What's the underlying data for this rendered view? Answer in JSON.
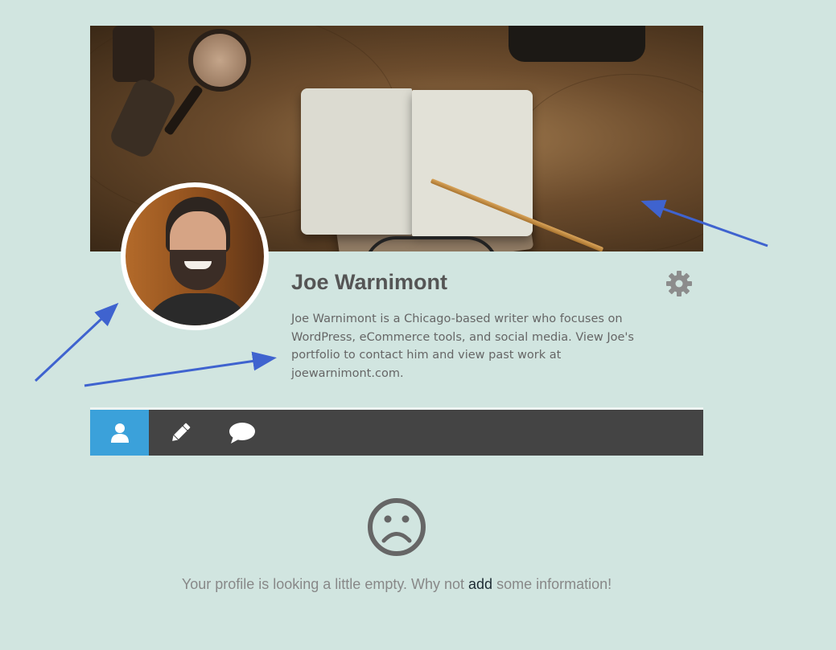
{
  "profile": {
    "name": "Joe Warnimont",
    "bio": "Joe Warnimont is a Chicago-based writer who focuses on WordPress, eCommerce tools, and social media. View Joe's portfolio to contact him and view past work at joewarnimont.com."
  },
  "tabs": [
    {
      "icon": "user-icon",
      "active": true
    },
    {
      "icon": "pencil-icon",
      "active": false
    },
    {
      "icon": "comment-icon",
      "active": false
    }
  ],
  "empty_state": {
    "icon": "sad-face-icon",
    "text_before": "Your profile is looking a little empty. Why not ",
    "link": "add",
    "text_after": " some information!"
  },
  "colors": {
    "background": "#d1e5e0",
    "tab_bar": "#444444",
    "tab_active": "#3ba1da",
    "arrow": "#3f63cf"
  },
  "settings_icon": "gear-icon"
}
